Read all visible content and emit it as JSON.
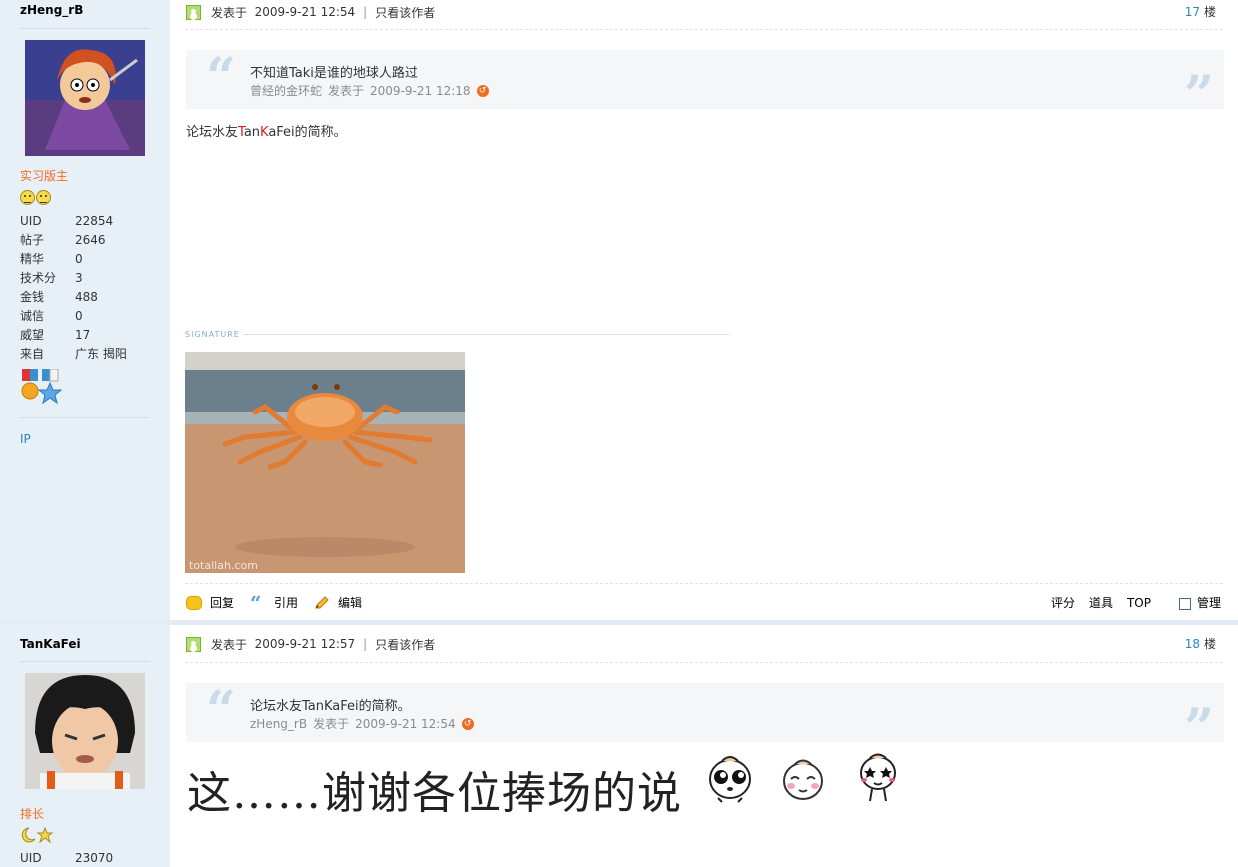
{
  "posts": [
    {
      "author": "zHeng_rB",
      "rank": "实习版主",
      "stats": [
        {
          "k": "UID",
          "v": "22854"
        },
        {
          "k": "帖子",
          "v": "2646"
        },
        {
          "k": "精华",
          "v": "0"
        },
        {
          "k": "技术分",
          "v": "3"
        },
        {
          "k": "金钱",
          "v": "488"
        },
        {
          "k": "诚信",
          "v": "0"
        },
        {
          "k": "威望",
          "v": "17"
        },
        {
          "k": "来自",
          "v": "广东 揭阳"
        }
      ],
      "ip_label": "IP",
      "posted_label": "发表于",
      "posted_time": "2009-9-21 12:54",
      "author_only": "只看该作者",
      "floor": "17",
      "floor_suffix": "楼",
      "quote_text": "不知道Taki是谁的地球人路过",
      "quote_author": "曾经的金环蛇",
      "quote_posted_label": "发表于",
      "quote_time": "2009-9-21 12:18",
      "body_before": "论坛水友",
      "body_t": "T",
      "body_an": "an",
      "body_k": "K",
      "body_afei": "aFei",
      "body_after": "的简称。",
      "signature_label": "SIGNATURE",
      "image_watermark": "totallah.com",
      "actions": {
        "reply": "回复",
        "quote": "引用",
        "edit": "编辑"
      },
      "right_actions": {
        "rate": "评分",
        "tools": "道具",
        "top": "TOP",
        "manage": "管理"
      }
    },
    {
      "author": "TanKaFei",
      "rank": "排长",
      "stats": [
        {
          "k": "UID",
          "v": "23070"
        }
      ],
      "posted_label": "发表于",
      "posted_time": "2009-9-21 12:57",
      "author_only": "只看该作者",
      "floor": "18",
      "floor_suffix": "楼",
      "quote_text": "论坛水友TanKaFei的简称。",
      "quote_author": "zHeng_rB",
      "quote_posted_label": "发表于",
      "quote_time": "2009-9-21 12:54",
      "big_text": "这……谢谢各位捧场的说"
    }
  ],
  "colors": {
    "sidebar_bg": "#e8f0f7",
    "link_blue": "#2a87b8",
    "rank_orange": "#f26c1d",
    "highlight_red": "#e01b1b",
    "quote_bg": "#f5f6f7"
  }
}
